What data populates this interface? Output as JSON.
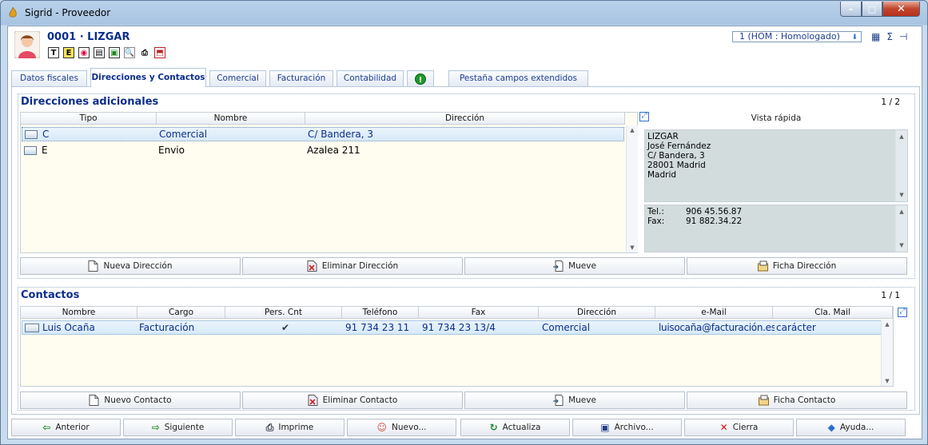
{
  "window": {
    "title": "Sigrid - Proveedor",
    "min_label": "–",
    "max_label": "□",
    "close_label": "✕"
  },
  "header": {
    "code_title": "0001 · LIZGAR",
    "toolbar_icons": [
      {
        "name": "text-t-icon",
        "glyph": "T"
      },
      {
        "name": "text-e-icon",
        "glyph": "E"
      },
      {
        "name": "color-wheel-icon",
        "glyph": "◉"
      },
      {
        "name": "id-card-icon",
        "glyph": "▤"
      },
      {
        "name": "export-icon",
        "glyph": "▣"
      },
      {
        "name": "preview-icon",
        "glyph": "🔍"
      },
      {
        "name": "printer-icon",
        "glyph": "⎙"
      },
      {
        "name": "pdf-icon",
        "glyph": "⬒"
      }
    ],
    "status_value": "1 (HOM : Homologado)",
    "status_arrow": "⬇",
    "right_icons": {
      "grid": "▦",
      "sigma": "Σ",
      "pin": "⊣"
    }
  },
  "tabs": [
    {
      "label": "Datos fiscales"
    },
    {
      "label": "Direcciones y Contactos"
    },
    {
      "label": "Comercial"
    },
    {
      "label": "Facturación"
    },
    {
      "label": "Contabilidad"
    },
    {
      "label": "Pestaña campos extendidos"
    }
  ],
  "addresses": {
    "title": "Direcciones adicionales",
    "count": "1 / 2",
    "columns": [
      "Tipo",
      "Nombre",
      "Dirección"
    ],
    "rows": [
      {
        "tipo": "C",
        "nombre": "Comercial",
        "direccion": "C/ Bandera, 3"
      },
      {
        "tipo": "E",
        "nombre": "Envio",
        "direccion": "Azalea 211"
      }
    ],
    "quick_view": {
      "label": "Vista rápida",
      "lines": [
        "LIZGAR",
        "José Fernández",
        "C/ Bandera, 3",
        "28001 Madrid",
        "Madrid"
      ],
      "tel_label": "Tel.:",
      "tel": "906 45.56.87",
      "fax_label": "Fax:",
      "fax": "91 882.34.22"
    },
    "buttons": {
      "new": "Nueva Dirección",
      "delete": "Eliminar Dirección",
      "move": "Mueve",
      "card": "Ficha Dirección"
    }
  },
  "contacts": {
    "title": "Contactos",
    "count": "1 / 1",
    "columns": [
      "Nombre",
      "Cargo",
      "Pers. Cnt",
      "Teléfono",
      "Fax",
      "Dirección",
      "e-Mail",
      "Cla. Mail"
    ],
    "rows": [
      {
        "nombre": "Luis Ocaña",
        "cargo": "Facturación",
        "pers": "✔",
        "telefono": "91 734 23 11",
        "fax": "91 734 23 13/4",
        "direccion": "Comercial",
        "email": "luisocaña@facturación.es",
        "clamail": "carácter"
      }
    ],
    "buttons": {
      "new": "Nuevo Contacto",
      "delete": "Eliminar Contacto",
      "move": "Mueve",
      "card": "Ficha Contacto"
    }
  },
  "footer": {
    "prev": "Anterior",
    "next": "Siguiente",
    "print": "Imprime",
    "new": "Nuevo...",
    "refresh": "Actualiza",
    "file": "Archivo...",
    "close": "Cierra",
    "help": "Ayuda..."
  }
}
